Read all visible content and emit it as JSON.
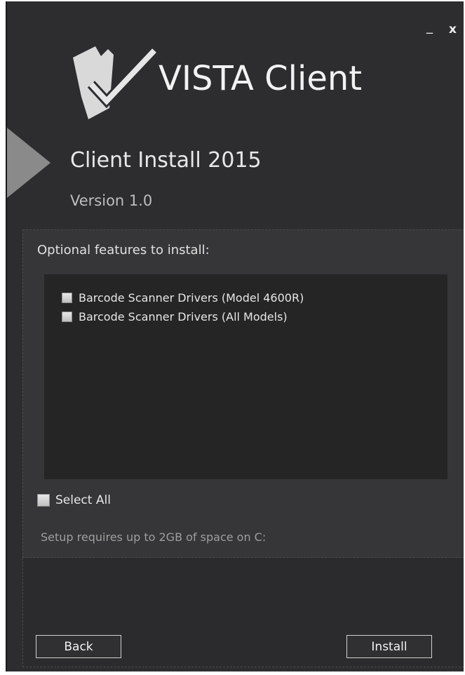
{
  "window": {
    "minimize_label": "_",
    "close_label": "x"
  },
  "header": {
    "logo_icon": "checkmark-document-icon",
    "product_name": "VISTA Client",
    "install_title": "Client Install 2015",
    "version": "Version 1.0"
  },
  "options": {
    "heading": "Optional features to install:",
    "features": [
      {
        "label": "Barcode Scanner Drivers (Model 4600R)",
        "checked": false
      },
      {
        "label": "Barcode Scanner Drivers (All Models)",
        "checked": false
      }
    ],
    "select_all_label": "Select All",
    "space_note": "Setup requires up to 2GB of space on C:"
  },
  "footer": {
    "back_label": "Back",
    "install_label": "Install"
  },
  "colors": {
    "background": "#2d2d30",
    "panel": "#363638",
    "list": "#252526",
    "arrow": "#8a8a8a"
  }
}
